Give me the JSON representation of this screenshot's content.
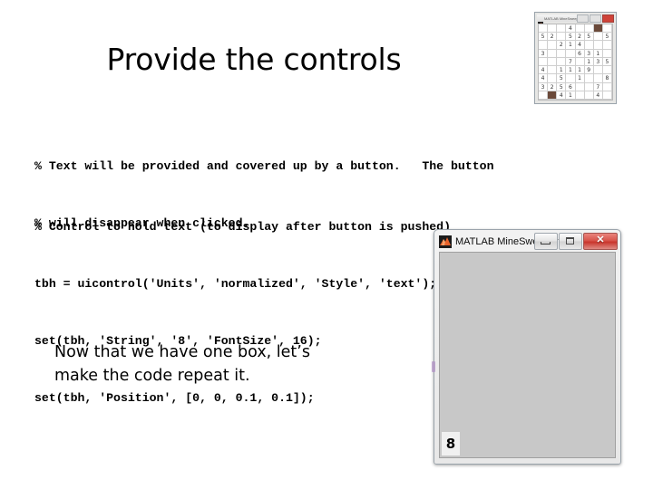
{
  "slide": {
    "title": "Provide the controls",
    "background_color": "#ffffff",
    "text_color": "#000000"
  },
  "code_comment_block": {
    "lines": [
      "% Text will be provided and covered up by a button.   The button",
      "% will disappear when clicked."
    ]
  },
  "code_main_block": {
    "lines": [
      "% Control to hold text (to display after button is pushed)",
      "tbh = uicontrol('Units', 'normalized', 'Style', 'text');",
      "set(tbh, 'String', '8', 'FontSize', 16);",
      "set(tbh, 'Position', [0, 0, 0.1, 0.1]);"
    ]
  },
  "caption": {
    "lines": [
      "Now that we have one box, let’s",
      "make the code repeat it."
    ]
  },
  "minesweeper_window": {
    "title": "MATLAB MineSweeper",
    "logo_icon": "matlab-membrane-icon",
    "controls": {
      "minimize_label": "–",
      "maximize_label": "□",
      "close_label": "✕"
    },
    "canvas_color": "#c8c8c8",
    "text_control_value": "8"
  },
  "minesweeper_thumbnail": {
    "title": "MATLAB MineSweeper",
    "logo_icon": "matlab-membrane-icon",
    "controls": {
      "minimize_label": "–",
      "maximize_label": "□",
      "close_label": "✕"
    },
    "grid": [
      [
        "",
        "",
        "",
        "4",
        "",
        "",
        "",
        ""
      ],
      [
        "5",
        "2",
        "",
        "5",
        "2",
        "5",
        "",
        "5"
      ],
      [
        "",
        "",
        "2",
        "1",
        "4",
        "",
        "",
        ""
      ],
      [
        "3",
        "",
        "",
        "",
        "6",
        "3",
        "1",
        ""
      ],
      [
        "",
        "",
        "",
        "7",
        "",
        "1",
        "3",
        "5"
      ],
      [
        "4",
        "",
        "1",
        "1",
        "1",
        "9",
        "",
        ""
      ],
      [
        "4",
        "",
        "5",
        "",
        "1",
        "",
        "",
        "8"
      ],
      [
        "3",
        "2",
        "5",
        "6",
        "",
        "",
        "7",
        ""
      ],
      [
        "",
        "",
        "4",
        "1",
        "",
        "",
        "4",
        ""
      ]
    ],
    "mine_cells": [
      [
        0,
        6
      ],
      [
        8,
        1
      ]
    ]
  }
}
